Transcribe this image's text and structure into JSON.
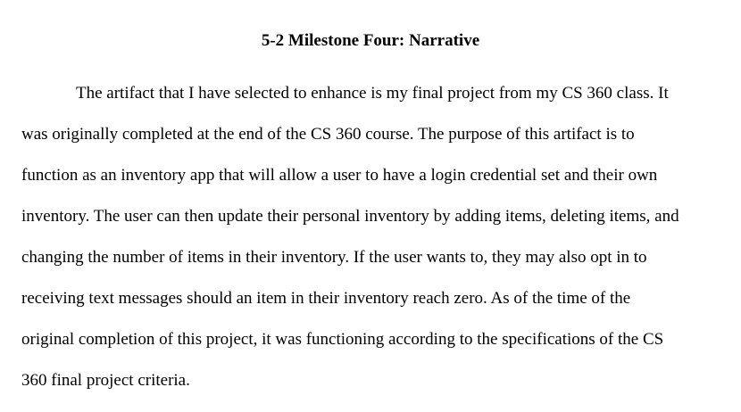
{
  "document": {
    "title": "5-2 Milestone Four: Narrative",
    "paragraph_lines": [
      "The artifact that I have selected to enhance is my final project from my CS 360 class. It",
      "was originally completed at the end of the CS 360 course. The purpose of this artifact is to",
      "function as an inventory app that will allow a user to have a login credential set and their own",
      "inventory. The user can then update their personal inventory by adding items, deleting items, and",
      "changing the number of items in their inventory. If the user wants to, they may also opt in to",
      "receiving text messages should an item in their inventory reach zero. As of the time of the",
      "original completion of this project, it was functioning according to the specifications of the CS",
      "360 final project criteria."
    ]
  }
}
